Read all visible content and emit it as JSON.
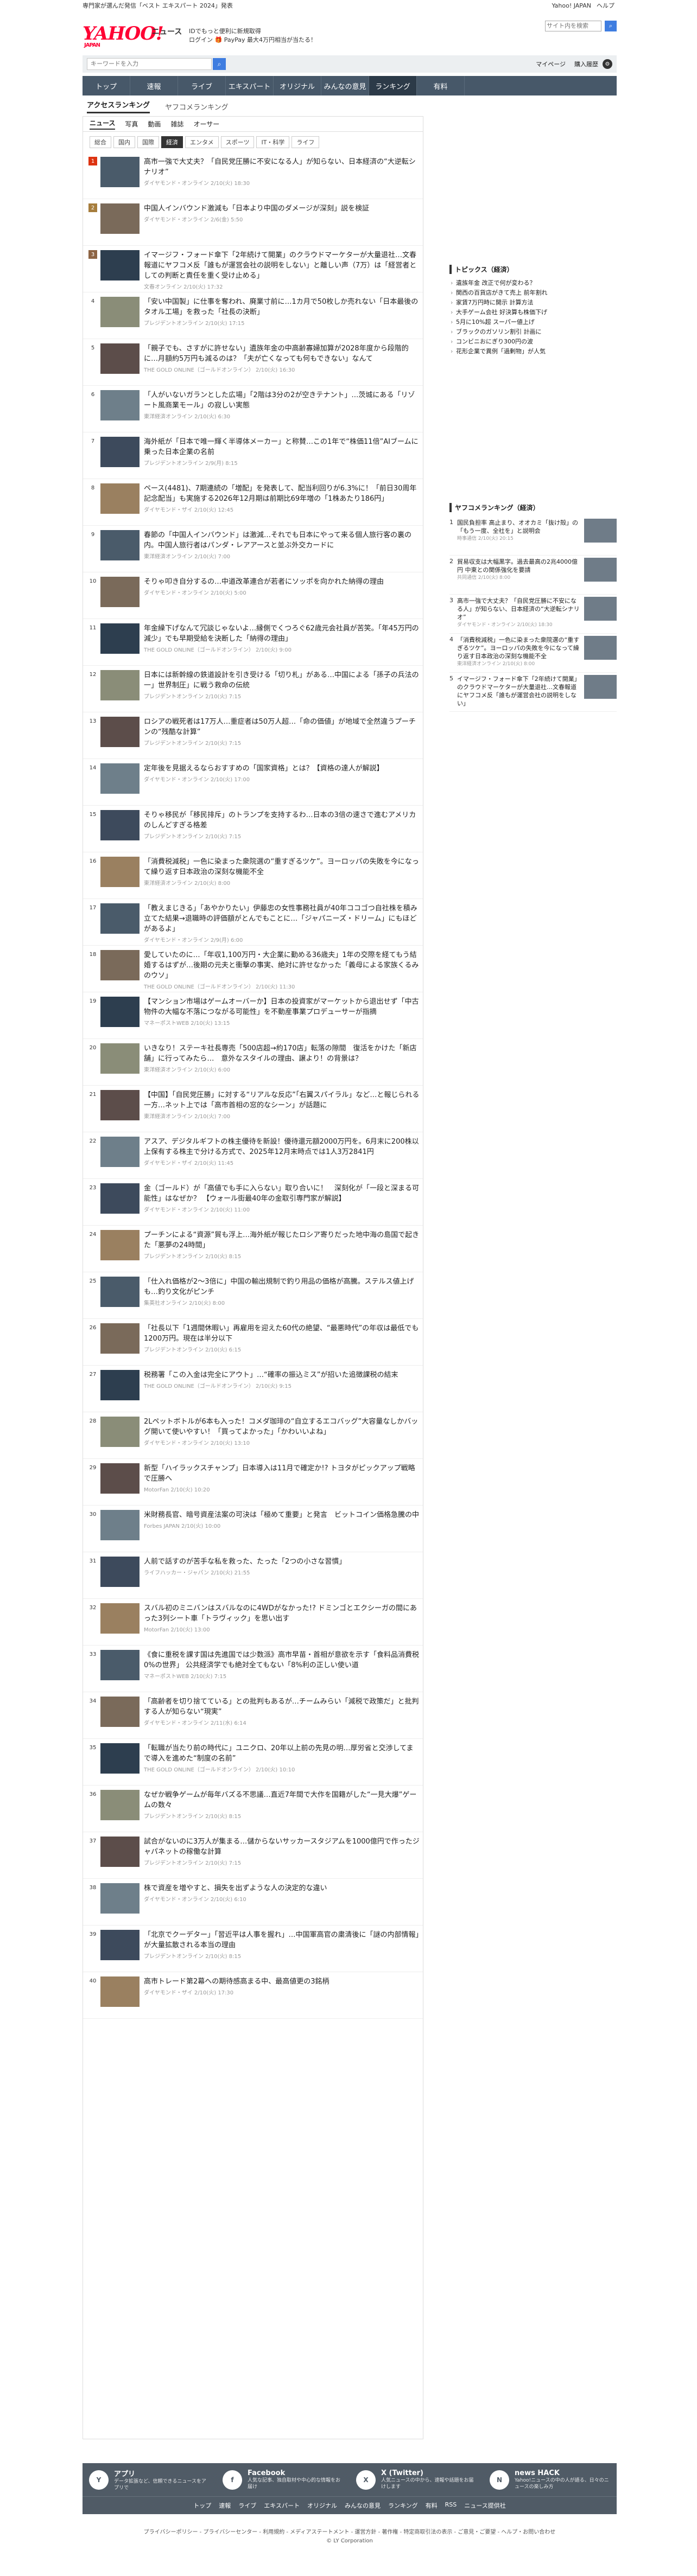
{
  "topbar": {
    "promo": "専門家が選んだ発信「ベスト エキスパート 2024」発表",
    "links": [
      "Yahoo! JAPAN",
      "ヘルプ"
    ],
    "site_search": "サイト内を検索"
  },
  "header": {
    "logo": "YAHOO!",
    "logo_sub": "JAPAN",
    "news": "ニュース",
    "info1": "IDでもっと便利に新規取得",
    "info2": "ログイン 🎁 PayPay 最大4万円相当が当たる！"
  },
  "toolbar": {
    "search_placeholder": "キーワードを入力",
    "mypage": "マイページ",
    "purchase": "購入履歴"
  },
  "gnav": [
    "トップ",
    "速報",
    "ライブ",
    "エキスパート",
    "オリジナル",
    "みんなの意見",
    "ランキング",
    "有料"
  ],
  "subtabs": {
    "active": "アクセスランキング",
    "other": "ヤフコメランキング"
  },
  "cattabs": [
    "ニュース",
    "写真",
    "動画",
    "雑誌",
    "オーサー"
  ],
  "subcats": [
    "総合",
    "国内",
    "国際",
    "経済",
    "エンタメ",
    "スポーツ",
    "IT・科学",
    "ライフ"
  ],
  "articles": [
    {
      "rank": "1",
      "title": "高市一強で大丈夫？「自民党圧勝に不安になる人」が知らない、日本経済の“大逆転シナリオ”",
      "meta": "ダイヤモンド・オンライン 2/10(火) 18:30"
    },
    {
      "rank": "2",
      "title": "中国人インバウンド激減も「日本より中国のダメージが深刻」説を検証",
      "meta": "ダイヤモンド・オンライン 2/6(金) 5:50"
    },
    {
      "rank": "3",
      "title": "イマージフ・フォード傘下「2年続けて開業」のクラウドマーケターが大量退社…文春報道にヤフコメ反「誰もが運営会社の説明をしない」と離しい声（7万）は「経営者としての判断と責任を重く受け止める」",
      "meta": "文春オンライン 2/10(火) 17:32"
    },
    {
      "rank": "4",
      "title": "「安い中国製」に仕事を奪われ、廃業寸前に…1カ月で50枚しか売れない「日本最後のタオル工場」を救った「社長の決断」",
      "meta": "プレジデントオンライン 2/10(火) 17:15"
    },
    {
      "rank": "5",
      "title": "「親子でも、さすがに許せない」遺族年金の中高齢寡婦加算が2028年度から段階的に…月額約5万円も減るのは？「夫が亡くなっても何もできない」なんて",
      "meta": "THE GOLD ONLINE（ゴールドオンライン） 2/10(火) 16:30"
    },
    {
      "rank": "6",
      "title": "「人がいないガランとした広場」「2階は3分の2が空きテナント」…茨城にある「リゾート風商業モール」の寂しい実態",
      "meta": "東洋経済オンライン 2/10(火) 6:30"
    },
    {
      "rank": "7",
      "title": "海外紙が「日本で唯一輝く半導体メーカー」と称賛…この1年で“株価11倍”AIブームに乗った日本企業の名前",
      "meta": "プレジデントオンライン 2/9(月) 8:15"
    },
    {
      "rank": "8",
      "title": "ペース(4481)、7期連続の「増配」を発表して、配当利回りが6.3%に！「前日30周年記念配当」も実施する2026年12月期は前期比69年増の「1株あたり186円」",
      "meta": "ダイヤモンド・ザイ 2/10(火) 12:45"
    },
    {
      "rank": "9",
      "title": "春節の「中国人インバウンド」は激減…それでも日本にやって来る個人旅行客の裏の内。中国人旅行者はパンダ・レアアースと並ぶ外交カードに",
      "meta": "東洋経済オンライン 2/10(火) 7:00"
    },
    {
      "rank": "10",
      "title": "そりゃ叩き自分するの…中道改革連合が若者にソッポを向かれた納得の理由",
      "meta": "ダイヤモンド・オンライン 2/10(火) 5:00"
    },
    {
      "rank": "11",
      "title": "年金繰下げなんて冗談じゃないよ…縁側でくつろぐ62歳元会社員が苦笑。「年45万円の減少」でも早期受給を決断した「納得の理由」",
      "meta": "THE GOLD ONLINE（ゴールドオンライン） 2/10(火) 9:00"
    },
    {
      "rank": "12",
      "title": "日本には新幹線の鉄道設計を引き受ける「切り札」がある…中国による「孫子の兵法の一」世界制圧」に戦う救命の伝統",
      "meta": "プレジデントオンライン 2/10(火) 7:15"
    },
    {
      "rank": "13",
      "title": "ロシアの戦死者は17万人…重症者は50万人超…「命の価値」が地域で全然違うプーチンの“残酷な計算”",
      "meta": "プレジデントオンライン 2/10(火) 7:15"
    },
    {
      "rank": "14",
      "title": "定年後を見据えるならおすすめの「国家資格」とは？【資格の達人が解説】",
      "meta": "ダイヤモンド・オンライン 2/10(火) 17:00"
    },
    {
      "rank": "15",
      "title": "そりゃ移民が「移民排斥」のトランプを支持するわ…日本の3倍の速さで進むアメリカのしんどすぎる格差",
      "meta": "プレジデントオンライン 2/10(火) 7:15"
    },
    {
      "rank": "16",
      "title": "「消費税減税」一色に染まった衆院選の“重すぎるツケ”。ヨーロッパの失敗を今になって繰り返す日本政治の深刻な機能不全",
      "meta": "東洋経済オンライン 2/10(火) 8:00"
    },
    {
      "rank": "17",
      "title": "「教えまじきる」「あやかりたい」伊藤忠の女性事務社員が40年ココゴつ自社株を積み立てた結果→退職時の評価額がとんでもことに…「ジャパニーズ・ドリーム」にもほどがあるよ」",
      "meta": "ダイヤモンド・オンライン 2/9(月) 6:00"
    },
    {
      "rank": "18",
      "title": "愛していたのに…「年収1,100万円・大企業に勤める36歳夫」1年の交際を経てもう結婚するはずが…後期の元夫と衝撃の事実、絶対に許せなかった「義母による家族くるみのウソ」",
      "meta": "THE GOLD ONLINE（ゴールドオンライン） 2/10(火) 11:30"
    },
    {
      "rank": "19",
      "title": "【マンション市場はゲームオーバーか】日本の投資家がマーケットから退出せず「中古物件の大幅な不落につながる可能性」を不動産事業プロデューサーが指摘",
      "meta": "マネーポストWEB 2/10(火) 13:15"
    },
    {
      "rank": "20",
      "title": "いきなり！ステーキ社長専売「500店超→約170店」転落の隙間　復活をかけた「新店舗」に行ってみたら…　意外なスタイルの理由、譲より！の背景は？",
      "meta": "東洋経済オンライン 2/10(火) 6:00"
    },
    {
      "rank": "21",
      "title": "【中国】「自民党圧勝」に対する“リアルな反応”「右翼スパイラル」など…と報じられる一方…ネット上では「高市首相の窓的なシーン」が話題に",
      "meta": "東洋経済オンライン 2/10(火) 7:00"
    },
    {
      "rank": "22",
      "title": "アスア、デジタルギフトの株主優待を新設！優待還元額2000万円を。6月末に200株以上保有する株主で分ける方式で、2025年12月末時点では1人3万2841円",
      "meta": "ダイヤモンド・ザイ 2/10(火) 11:45"
    },
    {
      "rank": "23",
      "title": "金（ゴールド）が「高値でも手に入らない」取り合いに！　深刻化が「一段と深まる可能性」はなぜか？ 【ウォール街最40年の金取引専門家が解説】",
      "meta": "ダイヤモンド・オンライン 2/10(火) 11:00"
    },
    {
      "rank": "24",
      "title": "プーチンによる“資源”貿も浮上…海外紙が報じたロシア寄りだった地中海の島国で起きた「悪夢の24時間」",
      "meta": "プレジデントオンライン 2/10(火) 8:15"
    },
    {
      "rank": "25",
      "title": "「仕入れ価格が2～3倍に」中国の輸出規制で釣り用品の価格が高騰。ステルス値上げも…釣り文化がピンチ",
      "meta": "集英社オンライン 2/10(火) 8:00"
    },
    {
      "rank": "26",
      "title": "「社長以下「1週間休暇い」再雇用を迎えた60代の絶望、“最悪時代”の年収は最低でも1200万円。現在は半分以下",
      "meta": "プレジデントオンライン 2/10(火) 6:15"
    },
    {
      "rank": "27",
      "title": "税務署「この入金は完全にアウト」…“確率の振込ミス”が招いた追徴課税の結末",
      "meta": "THE GOLD ONLINE（ゴールドオンライン） 2/10(火) 9:15"
    },
    {
      "rank": "28",
      "title": "2Lペットボトルが6本も入った！コメダ珈琲の“自立するエコバッグ”大容量なしかバッグ開いて使いやすい！「買ってよかった」「かわいいよね」",
      "meta": "ダイヤモンド・オンライン 2/10(火) 13:10"
    },
    {
      "rank": "29",
      "title": "新型「ハイラックスチャンプ」日本導入は11月で確定か!? トヨタがピックアップ戦略で圧勝へ",
      "meta": "MotorFan 2/10(火) 10:20"
    },
    {
      "rank": "30",
      "title": "米財務長官、暗号資産法案の可決は「極めて重要」と発言　ビットコイン価格急騰の中",
      "meta": "Forbes JAPAN 2/10(火) 10:00"
    },
    {
      "rank": "31",
      "title": "人前で話すのが苦手な私を救った、たった「2つの小さな習慣」",
      "meta": "ライフハッカー・ジャパン 2/10(火) 21:55"
    },
    {
      "rank": "32",
      "title": "スバル初のミニバンはスバルなのに4WDがなかった!? ドミンゴとエクシーガの間にあった3列シート車「トラヴィック」を思い出す",
      "meta": "MotorFan 2/10(火) 13:00"
    },
    {
      "rank": "33",
      "title": "《食に重税を課す国は先進国では少数派》高市早苗・首相が意欲を示す「食料品消費税0%の世界」 公共経済学でも絶対全てもない「8%利の正しい使い道",
      "meta": "マネーポストWEB 2/10(火) 7:15"
    },
    {
      "rank": "34",
      "title": "「高齢者を切り捨てている」との批判もあるが…チームみらい「減税で政策だ」と批判する人が知らない“現実”",
      "meta": "ダイヤモンド・オンライン 2/11(水) 6:14"
    },
    {
      "rank": "35",
      "title": "「転職が当たり前の時代に」ユニクロ、20年以上前の先見の明…厚労省と交渉してまで導入を進めた“制度の名前”",
      "meta": "THE GOLD ONLINE（ゴールドオンライン） 2/10(火) 10:10"
    },
    {
      "rank": "36",
      "title": "なぜか戦争ゲームが毎年バズる不思議…直近7年間で大作を国籍がした“一見大爆”ゲームの数々",
      "meta": "プレジデントオンライン 2/10(火) 8:15"
    },
    {
      "rank": "37",
      "title": "試合がないのに3万人が集まる…儲からないサッカースタジアムを1000億円で作ったジャパネットの稼働な計算",
      "meta": "プレジデントオンライン 2/10(火) 7:15"
    },
    {
      "rank": "38",
      "title": "株で資産を増やすと、損失を出ずような人の決定的な違い",
      "meta": "ダイヤモンド・オンライン 2/10(火) 6:10"
    },
    {
      "rank": "39",
      "title": "「北京でクーデター」「習近平は人事を握れ」…中国軍高官の粛清後に「謎の内部情報」が大量拡散される本当の理由",
      "meta": "プレジデントオンライン 2/10(火) 8:15"
    },
    {
      "rank": "40",
      "title": "高市トレード第2幕への期待感高まる中、最高値更の3銘柄",
      "meta": "ダイヤモンド・ザイ 2/10(火) 17:30"
    }
  ],
  "topics": {
    "heading": "トピックス（経済）",
    "items": [
      "遺族年金 改正で何が変わる？",
      "関西の百貨店がきて売上 前年割れ",
      "家賃7万円時に開示 計算方法",
      "大手ゲーム会社 好決算も株価下げ",
      "5月に10%超 スーパー値上げ",
      "ブラックのガソリン割引 計画に",
      "コンビニおにぎり300円の波",
      "花形企業で異例「過剰物」が人気"
    ]
  },
  "ranking2": {
    "heading": "ヤフコメランキング（経済）",
    "items": [
      {
        "rank": "1",
        "title": "国民負担率 高止まり、オオカミ「抜け殻」の「もう一度、全社を」と説明会",
        "meta": "時事通信 2/10(火) 20:15"
      },
      {
        "rank": "2",
        "title": "貿易収支は大幅黒字。過去最高の2兆4000億円 中東との関係強化を要請",
        "meta": "共同通信 2/10(火) 8:00"
      },
      {
        "rank": "3",
        "title": "高市一強で大丈夫？「自民党圧勝に不安になる人」が知らない、日本経済の“大逆転シナリオ”",
        "meta": "ダイヤモンド・オンライン 2/10(火) 18:30"
      },
      {
        "rank": "4",
        "title": "「消費税減税」一色に染まった衆院選の“重すぎるツケ”。ヨーロッパの失敗を今になって繰り返す日本政治の深刻な機能不全",
        "meta": "東洋経済オンライン 2/10(火) 8:00"
      },
      {
        "rank": "5",
        "title": "イマージフ・フォード傘下「2年続けて開業」のクラウドマーケターが大量退社…文春報道にヤフコメ反「誰もが運営会社の説明をしない」",
        "meta": "文春オンライン 2/10(火) 17:32"
      }
    ]
  },
  "footer": {
    "apps": [
      {
        "name": "アプリ",
        "desc": "データ拡張など、信頼できるニュースをアプリで",
        "icon": "app-icon"
      },
      {
        "name": "Facebook",
        "desc": "人気な記事、独自取材や中心的な情報をお届け",
        "icon": "facebook-icon"
      },
      {
        "name": "X (Twitter)",
        "desc": "人気ニュースの中から、速報や話題をお届けします",
        "icon": "x-icon"
      },
      {
        "name": "news HACK",
        "desc": "Yahoo!ニュースの中の人が語る、日々のニュースの楽しみ方",
        "icon": "newshack-icon"
      }
    ],
    "links": [
      "トップ",
      "速報",
      "ライブ",
      "エキスパート",
      "オリジナル",
      "みんなの意見",
      "ランキング",
      "有料",
      "RSS",
      "ニュース提供社"
    ],
    "legal": "プライバシーポリシー - プライバシーセンター - 利用規約 - メディアステートメント - 運営方針 - 著作権 - 特定商取引法の表示 - ご意見・ご要望 - ヘルプ・お問い合わせ",
    "copyright": "© LY Corporation"
  },
  "colors": {
    "brand": "#ff0033",
    "nav": "#475869",
    "nav_active": "#2c3a48",
    "rank1": "#dd3311"
  }
}
